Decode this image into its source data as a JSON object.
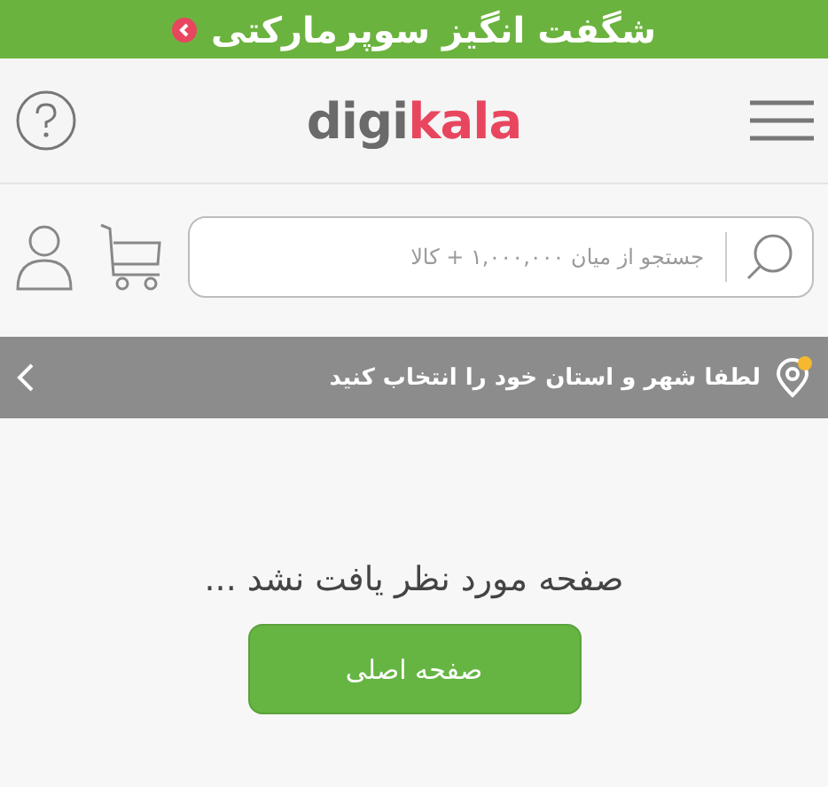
{
  "promo_banner": {
    "text": "شگفت انگیز سوپرمارکتی"
  },
  "header": {
    "logo": {
      "prefix": "digi",
      "suffix": "kala"
    }
  },
  "search": {
    "placeholder": "جستجو از میان ۱,۰۰۰,۰۰۰ + کالا"
  },
  "location_bar": {
    "text": "لطفا شهر و استان خود را انتخاب کنید",
    "alert": true
  },
  "message": "صفحه مورد نظر یافت نشد ...",
  "home_button": "صفحه اصلی"
}
